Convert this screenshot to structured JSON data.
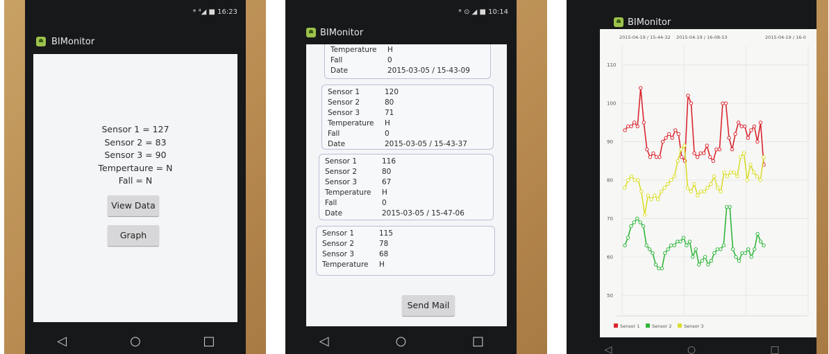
{
  "app_title": "BIMonitor",
  "screen1": {
    "status_time": "16:23",
    "status_icons": "* ⁴◢ ■",
    "readings": [
      "Sensor 1  = 127",
      "Sensor 2  = 83",
      "Sensor 3  = 90",
      "Tempertaure = N",
      "Fall = N"
    ],
    "view_data_label": "View Data",
    "graph_label": "Graph"
  },
  "screen2": {
    "status_time": "10:14",
    "status_icons": "* ⊙ ◢ ■",
    "partial_top": [
      {
        "k": "Temperature",
        "v": "H"
      },
      {
        "k": "Fall",
        "v": "0"
      },
      {
        "k": "Date",
        "v": "2015-03-05 /  15-43-09"
      }
    ],
    "cards": [
      {
        "rows": [
          {
            "k": "Sensor 1",
            "v": "120"
          },
          {
            "k": "Sensor 2",
            "v": "80"
          },
          {
            "k": "Sensor 3",
            "v": "71"
          },
          {
            "k": "Temperature",
            "v": "H"
          },
          {
            "k": "Fall",
            "v": "0"
          },
          {
            "k": "Date",
            "v": "2015-03-05 /  15-43-37"
          }
        ]
      },
      {
        "rows": [
          {
            "k": "Sensor 1",
            "v": "116"
          },
          {
            "k": "Sensor 2",
            "v": "80"
          },
          {
            "k": "Sensor 3",
            "v": "67"
          },
          {
            "k": "Temperature",
            "v": "H"
          },
          {
            "k": "Fall",
            "v": "0"
          },
          {
            "k": "Date",
            "v": "2015-03-05 /  15-47-06"
          }
        ]
      },
      {
        "rows": [
          {
            "k": "Sensor 1",
            "v": "115"
          },
          {
            "k": "Sensor 2",
            "v": "78"
          },
          {
            "k": "Sensor 3",
            "v": "68"
          },
          {
            "k": "Temperature",
            "v": "H"
          }
        ]
      }
    ],
    "send_mail_label": "Send Mail"
  },
  "screen3": {
    "top_labels": [
      "2015-04-19 /  15-44-32",
      "2015-04-19 /  16-08-53",
      "2015-04-19 /  16-0"
    ]
  },
  "nav": {
    "back": "◁",
    "home": "○",
    "recent": "□"
  },
  "colors": {
    "sensor1": "#d8262e",
    "sensor2": "#2fb53a",
    "sensor3": "#d9dd2a"
  },
  "chart_data": {
    "type": "line",
    "title": "",
    "xlabel": "",
    "ylabel": "",
    "yticks": [
      50,
      60,
      70,
      80,
      90,
      100,
      110
    ],
    "ylim": [
      45,
      115
    ],
    "grid": true,
    "legend_position": "bottom-left",
    "series": [
      {
        "name": "Sensor 1",
        "color": "#d8262e",
        "values": [
          93,
          94,
          94,
          95,
          94,
          104,
          95,
          88,
          86,
          87,
          86,
          86,
          90,
          91,
          92,
          91,
          93,
          92,
          86,
          85,
          102,
          100,
          87,
          86,
          87,
          87,
          89,
          86,
          85,
          88,
          88,
          100,
          100,
          91,
          88,
          92,
          95,
          94,
          94,
          91,
          93,
          94,
          90,
          95,
          84
        ]
      },
      {
        "name": "Sensor 2",
        "color": "#2fb53a",
        "values": [
          63,
          65,
          68,
          69,
          70,
          69,
          68,
          63,
          62,
          61,
          58,
          57,
          57,
          61,
          62,
          63,
          63,
          64,
          64,
          65,
          63,
          64,
          60,
          62,
          58,
          59,
          60,
          58,
          59,
          61,
          62,
          62,
          63,
          73,
          73,
          62,
          60,
          59,
          61,
          61,
          62,
          60,
          62,
          66,
          64,
          63
        ]
      },
      {
        "name": "Sensor 3",
        "color": "#d9dd2a",
        "values": [
          78,
          80,
          81,
          80,
          80,
          77,
          71,
          76,
          75,
          76,
          75,
          77,
          78,
          79,
          80,
          81,
          85,
          88,
          89,
          78,
          77,
          79,
          76,
          77,
          77,
          78,
          79,
          81,
          78,
          77,
          82,
          81,
          82,
          82,
          81,
          86,
          87,
          80,
          84,
          82,
          81,
          80,
          86
        ]
      }
    ]
  }
}
